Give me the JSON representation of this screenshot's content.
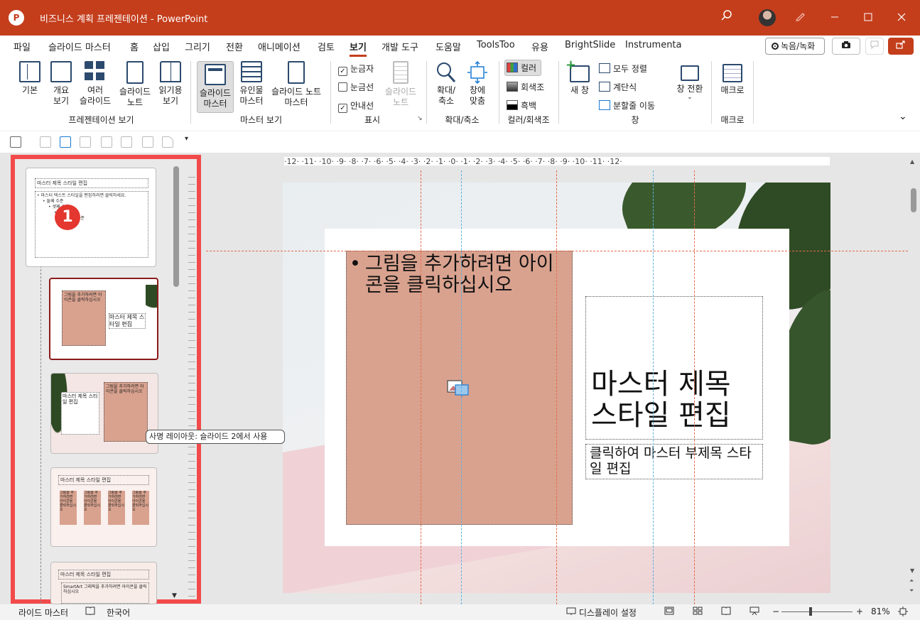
{
  "app": {
    "icon_letter": "P",
    "title": "비즈니스 계획 프레젠테이션  -  PowerPoint"
  },
  "titlebar_icons": [
    "search-icon",
    "avatar",
    "pen-icon",
    "minimize-icon",
    "maximize-icon",
    "close-icon"
  ],
  "tabs": [
    "파일",
    "슬라이드 마스터",
    "홈",
    "삽입",
    "그리기",
    "전환",
    "애니메이션",
    "검토",
    "보기",
    "개발 도구",
    "도움말",
    "ToolsToo",
    "유용",
    "BrightSlide",
    "Instrumenta"
  ],
  "active_tab": "보기",
  "tab_right": {
    "record_label": "녹음/녹화",
    "accent_color": "#c43e1c"
  },
  "ribbon": {
    "presentation_views": {
      "buttons": [
        "기본",
        "개요\n보기",
        "여러\n슬라이드",
        "슬라이드\n노트",
        "읽기용\n보기"
      ],
      "label": "프레젠테이션 보기"
    },
    "master_views": {
      "buttons": [
        "슬라이드\n마스터",
        "유인물\n마스터",
        "슬라이드 노트\n마스터"
      ],
      "label": "마스터 보기"
    },
    "show": {
      "ruler": "눈금자",
      "gridlines": "눈금선",
      "guides": "안내선",
      "notes": "슬라이드\n노트",
      "label": "표시",
      "ruler_checked": true,
      "gridlines_checked": false,
      "guides_checked": true
    },
    "zoom": {
      "zoom_btn": "확대/\n축소",
      "fit_btn": "창에\n맞춤",
      "label": "확대/축소"
    },
    "color": {
      "color": "컬러",
      "grayscale": "회색조",
      "bw": "흑백",
      "label": "컬러/회색조"
    },
    "window": {
      "new_window": "새 창",
      "arrange_all": "모두 정렬",
      "cascade": "계단식",
      "move_split": "분할줄 이동",
      "switch": "창 전환",
      "label": "창"
    },
    "macros": {
      "macro": "매크로",
      "label": "매크로"
    }
  },
  "marker_number": "1",
  "thumbnails": {
    "master_title": "마스터 제목 스타일 편집",
    "master_body": "• 마스터 텍스트 스타일을 편집하려면 클릭하세요.",
    "master_level2": "• 둘째 수준",
    "master_level3": "• 셋째 수준",
    "master_level4": "• 넷째 수준",
    "master_level5": "• 다섯째 수준",
    "layout1_pic": "그림을 추가하려면 아이콘을 클릭하십시오",
    "layout1_title": "마스터 제목 스타일 편집",
    "layout2_title": "마스터 제목 스타일 편집",
    "layout2_pic": "그림을 추가하려면 아이콘을 클릭하십시오",
    "layout3_title": "마스터 제목 스타일 편집",
    "layout3_col": "그림을 추가하려면 아이콘을 클릭하십시오",
    "layout4_title": "마스터 제목 스타일 편집",
    "layout4_body": "SmartArt 그래픽을 추가하려면 아이콘을 클릭하십시오"
  },
  "tooltip": "사명 레이아웃: 슬라이드 2에서 사용",
  "ruler": "·12· ·11· ·10· ·9· ·8· ·7· ·6· ·5· ·4· ·3· ·2· ·1· ·0· ·1· ·2· ·3· ·4· ·5· ·6· ·7· ·8· ·9· ·10· ·11· ·12·",
  "slide": {
    "picture_placeholder": "그림을 추가하려면 아이콘을 클릭하십시오",
    "bullet": "•",
    "title": "마스터 제목\n스타일 편집",
    "subtitle": "클릭하여 마스터 부제목 스타일 편집"
  },
  "statusbar": {
    "view_name": "라이드 마스터",
    "language": "한국어",
    "display_settings": "디스플레이 설정",
    "zoom_minus": "−",
    "zoom_plus": "+",
    "zoom": "81%"
  }
}
